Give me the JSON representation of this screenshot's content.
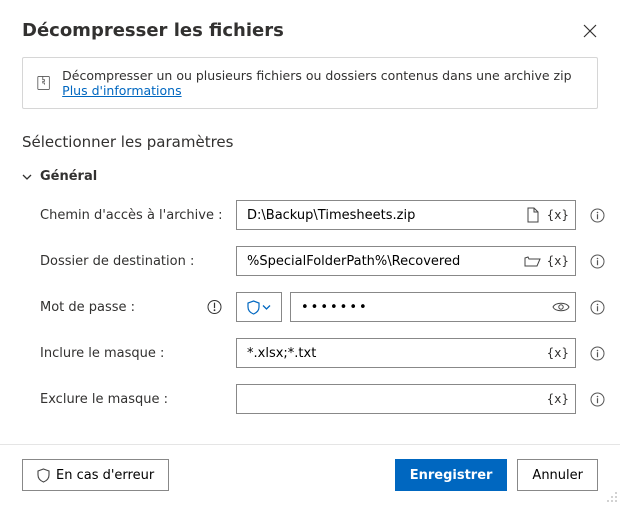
{
  "dialog": {
    "title": "Décompresser les fichiers",
    "banner": {
      "text": "Décompresser un ou plusieurs fichiers ou dossiers contenus dans une archive zip ",
      "link": "Plus d'informations"
    },
    "section_title": "Sélectionner les paramètres",
    "group_general": "Général",
    "fields": {
      "archive_path": {
        "label": "Chemin d'accès à l'archive :",
        "value": "D:\\Backup\\Timesheets.zip"
      },
      "destination": {
        "label": "Dossier de destination :",
        "value": "%SpecialFolderPath%\\Recovered"
      },
      "password": {
        "label": "Mot de passe :",
        "value": "•••••••"
      },
      "include_mask": {
        "label": "Inclure le masque :",
        "value": "*.xlsx;*.txt"
      },
      "exclude_mask": {
        "label": "Exclure le masque :",
        "value": ""
      }
    },
    "var_label": "{x}"
  },
  "footer": {
    "on_error": "En cas d'erreur",
    "save": "Enregistrer",
    "cancel": "Annuler"
  }
}
